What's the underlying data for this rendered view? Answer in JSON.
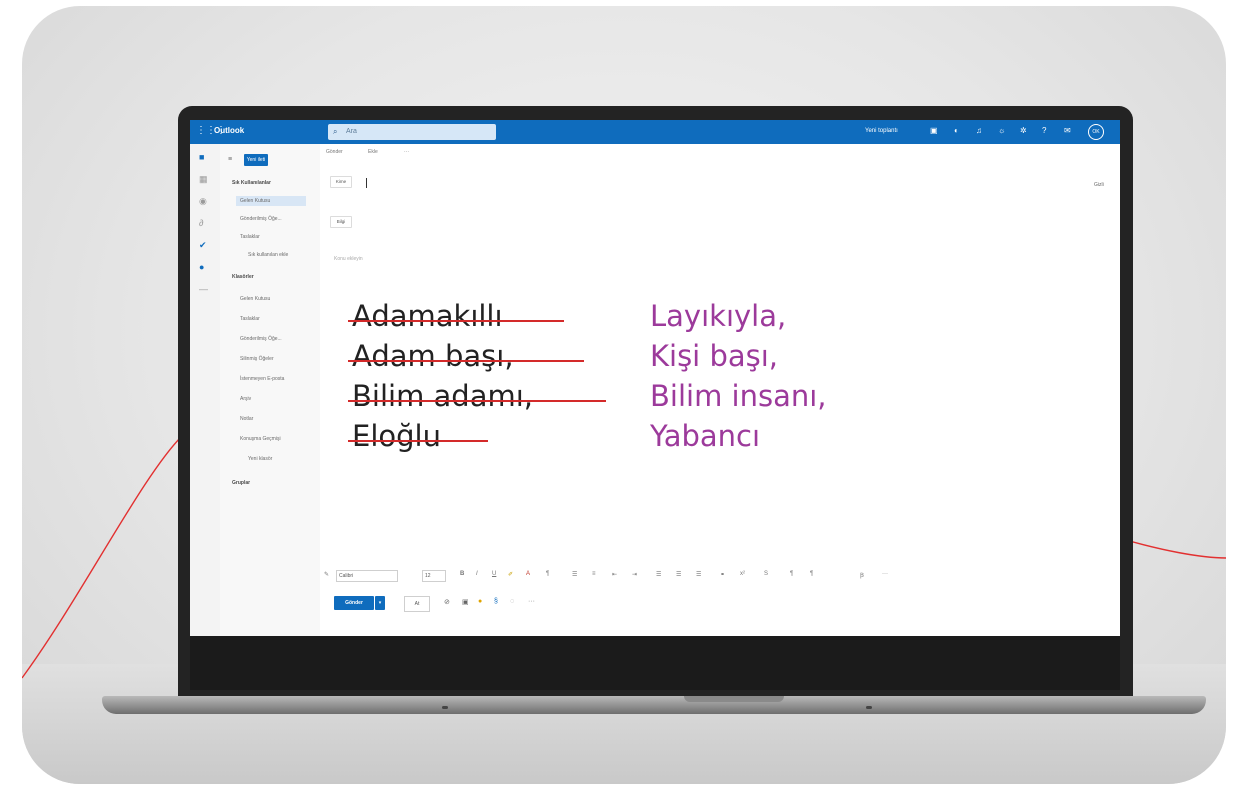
{
  "app": {
    "title": "Outlook",
    "search_placeholder": "Ara",
    "meeting": "Yeni toplantı",
    "avatar": "OK"
  },
  "toolbar": {
    "new_mail": "Yeni ileti",
    "discard": "Gönder",
    "insert": "Ekle",
    "more": "···"
  },
  "folders": {
    "favorites": "Sık Kullanılanlar",
    "items": [
      "Gelen Kutusu",
      "Gönderilmiş Öğe...",
      "Taslaklar",
      "Sık kullanılan ekle"
    ],
    "folders_head": "Klasörler",
    "folder_items": [
      "Gelen Kutusu",
      "Taslaklar",
      "Gönderilmiş Öğe...",
      "Silinmiş Öğeler",
      "İstenmeyen E-posta",
      "Arşiv",
      "Notlar",
      "Konuşma Geçmişi",
      "Yeni klasör"
    ],
    "groups": "Gruplar"
  },
  "compose": {
    "to_label": "Kime",
    "cc_label": "Bilgi",
    "cc_link": "Gizli",
    "subject_placeholder": "Konu ekleyin",
    "old_words": [
      "Adamakıllı",
      "Adam başı,",
      "Bilim adamı,",
      "Eloğlu"
    ],
    "new_words": [
      "Layıkıyla,",
      "Kişi başı,",
      "Bilim insanı,",
      "Yabancı"
    ],
    "strike_color": "#d42a2a",
    "new_word_color": "#9c3a9b"
  },
  "format": {
    "font": "Calibri",
    "size": "12"
  },
  "send": {
    "send_label": "Gönder",
    "discard_label": "At"
  }
}
